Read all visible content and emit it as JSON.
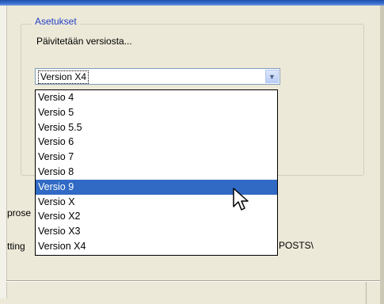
{
  "group": {
    "title": "Asetukset"
  },
  "update_label": "Päivitetään versiosta...",
  "combo": {
    "value": "Version X4",
    "button_icon": "chevron-down-icon"
  },
  "dropdown": {
    "items": [
      {
        "label": "Versio 4",
        "selected": false
      },
      {
        "label": "Versio 5",
        "selected": false
      },
      {
        "label": "Versio 5.5",
        "selected": false
      },
      {
        "label": "Versio 6",
        "selected": false
      },
      {
        "label": "Versio 7",
        "selected": false
      },
      {
        "label": "Versio 8",
        "selected": false
      },
      {
        "label": "Versio 9",
        "selected": true
      },
      {
        "label": "Versio X",
        "selected": false
      },
      {
        "label": "Versio X2",
        "selected": false
      },
      {
        "label": "Versio X3",
        "selected": false
      },
      {
        "label": "Version X4",
        "selected": false
      }
    ]
  },
  "behind_text": {
    "left_upper": "prose",
    "left_lower": "tting",
    "right_lower": "POSTS\\"
  },
  "colors": {
    "selection": "#316ac5",
    "group_title": "#2441c5",
    "window_bg": "#ece9d8"
  }
}
